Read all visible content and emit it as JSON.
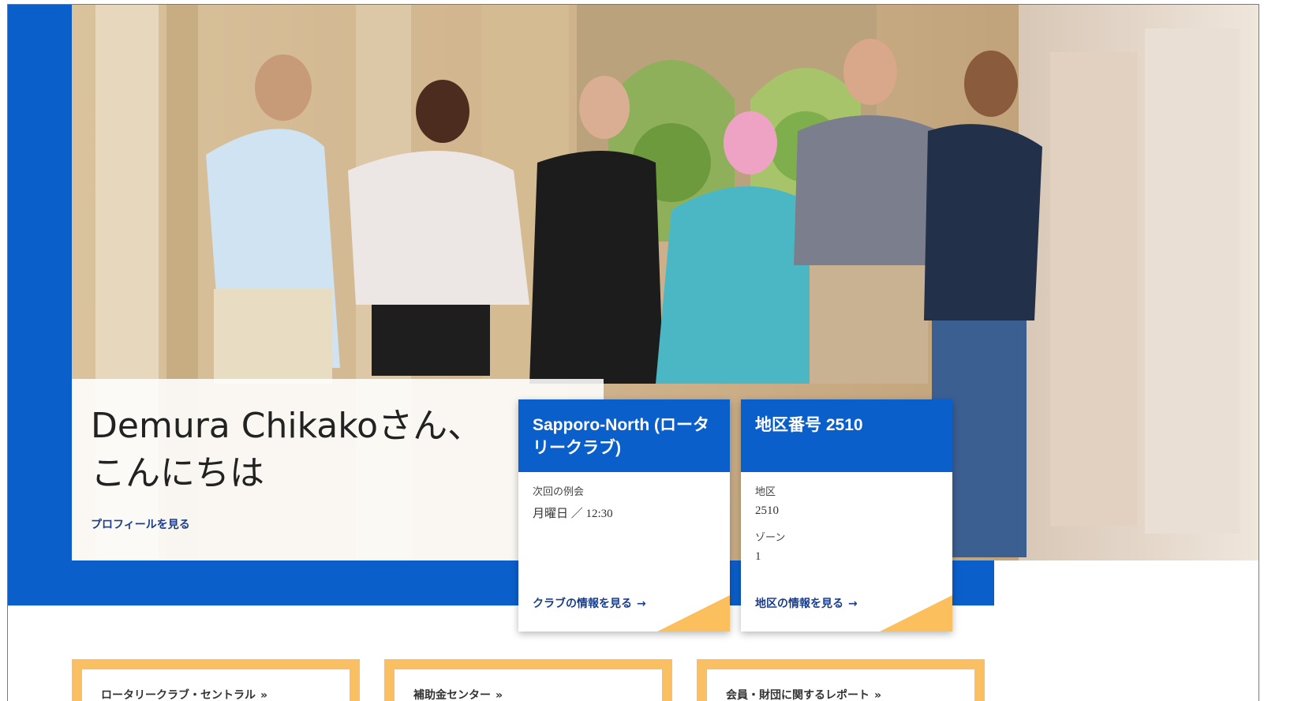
{
  "greeting": {
    "title": "Demura Chikakoさん、こんにちは",
    "profile_link": "プロフィールを見る"
  },
  "club_card": {
    "title": "Sapporo-North (ロータリークラブ)",
    "fields": [
      {
        "label": "次回の例会",
        "value": "月曜日 ／ 12:30"
      }
    ],
    "link": "クラブの情報を見る",
    "arrow": "→"
  },
  "district_card": {
    "title": "地区番号 2510",
    "fields": [
      {
        "label": "地区",
        "value": "2510"
      },
      {
        "label": "ゾーン",
        "value": "1"
      }
    ],
    "link": "地区の情報を見る",
    "arrow": "→"
  },
  "quick_links": [
    {
      "label": "ロータリークラブ・セントラル",
      "chevron": "»"
    },
    {
      "label": "補助金センター",
      "chevron": "»"
    },
    {
      "label": "会員・財団に関するレポート",
      "chevron": "»"
    }
  ],
  "colors": {
    "brand_blue": "#0b5fcb",
    "accent_gold": "#f9bf62",
    "link_navy": "#1a3e8c"
  }
}
